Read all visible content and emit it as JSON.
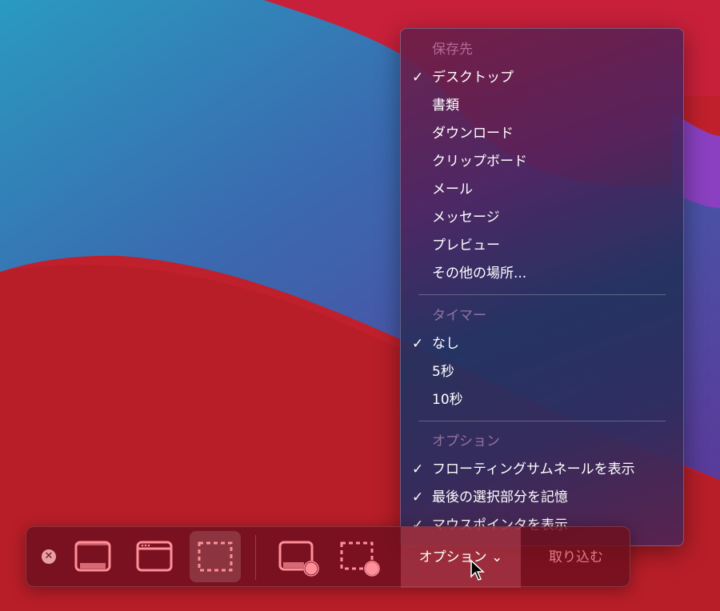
{
  "menu": {
    "save_header": "保存先",
    "save_items": [
      {
        "label": "デスクトップ",
        "checked": true
      },
      {
        "label": "書類",
        "checked": false
      },
      {
        "label": "ダウンロード",
        "checked": false
      },
      {
        "label": "クリップボード",
        "checked": false
      },
      {
        "label": "メール",
        "checked": false
      },
      {
        "label": "メッセージ",
        "checked": false
      },
      {
        "label": "プレビュー",
        "checked": false
      },
      {
        "label": "その他の場所...",
        "checked": false
      }
    ],
    "timer_header": "タイマー",
    "timer_items": [
      {
        "label": "なし",
        "checked": true
      },
      {
        "label": "5秒",
        "checked": false
      },
      {
        "label": "10秒",
        "checked": false
      }
    ],
    "options_header": "オプション",
    "options_items": [
      {
        "label": "フローティングサムネールを表示",
        "checked": true
      },
      {
        "label": "最後の選択部分を記憶",
        "checked": true
      },
      {
        "label": "マウスポインタを表示",
        "checked": true
      }
    ],
    "check_glyph": "✓"
  },
  "toolbar": {
    "close_glyph": "✕",
    "options_label": "オプション",
    "options_chevron": "⌄",
    "capture_label": "取り込む",
    "icon_color": "#ff8f98"
  }
}
